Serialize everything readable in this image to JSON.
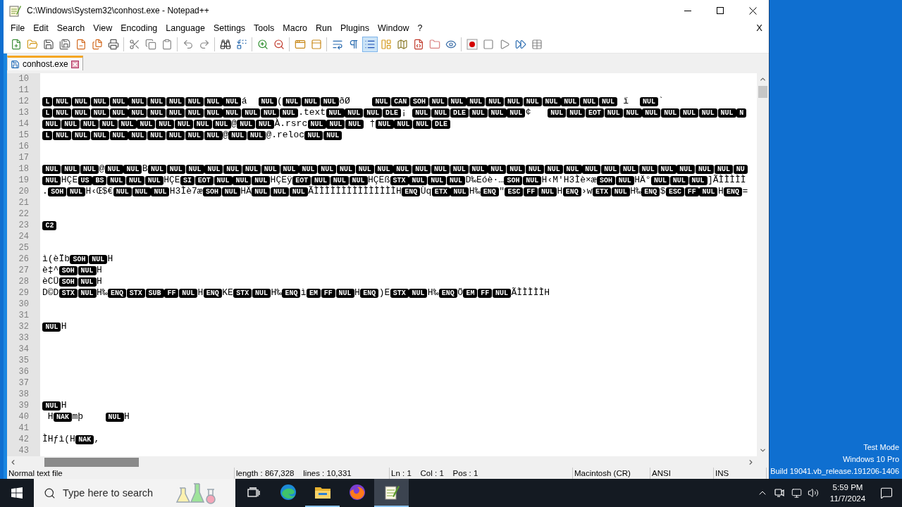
{
  "window": {
    "title": "C:\\Windows\\System32\\conhost.exe - Notepad++"
  },
  "menu": {
    "items": [
      "File",
      "Edit",
      "Search",
      "View",
      "Encoding",
      "Language",
      "Settings",
      "Tools",
      "Macro",
      "Run",
      "Plugins",
      "Window",
      "?"
    ],
    "close_label": "X"
  },
  "toolbar": {
    "groups": [
      [
        {
          "pressed": false
        },
        {
          "pressed": false
        },
        {
          "pressed": false
        },
        {
          "pressed": false
        },
        {
          "pressed": false
        },
        {
          "pressed": false
        },
        {
          "pressed": false
        }
      ],
      [
        {
          "pressed": false
        },
        {
          "pressed": false
        },
        {
          "pressed": false
        }
      ],
      [
        {
          "pressed": false
        },
        {
          "pressed": false
        }
      ],
      [
        {
          "pressed": false
        },
        {
          "pressed": false
        }
      ],
      [
        {
          "pressed": false
        },
        {
          "pressed": false
        }
      ],
      [
        {
          "pressed": false
        },
        {
          "pressed": false
        }
      ],
      [
        {
          "pressed": false
        },
        {
          "pressed": false
        },
        {
          "pressed": true
        },
        {
          "pressed": false
        },
        {
          "pressed": false
        },
        {
          "pressed": false
        },
        {
          "pressed": false
        },
        {
          "pressed": false
        }
      ],
      [
        {
          "pressed": false
        },
        {
          "pressed": false
        },
        {
          "pressed": false
        },
        {
          "pressed": false
        },
        {
          "pressed": false
        }
      ]
    ]
  },
  "tabs": [
    {
      "label": "conhost.exe",
      "selected": true
    }
  ],
  "editor": {
    "lines": [
      {
        "number": "10"
      },
      {
        "number": "11"
      },
      {
        "number": "12",
        "segments": [
          {
            "kind": "ctrl",
            "text": "L"
          },
          {
            "kind": "ctrl",
            "text": "NUL"
          },
          {
            "kind": "ctrl",
            "text": "NUL"
          },
          {
            "kind": "ctrl",
            "text": "NUL"
          },
          {
            "kind": "ctrl",
            "text": "NUL"
          },
          {
            "kind": "ctrl",
            "text": "NUL"
          },
          {
            "kind": "ctrl",
            "text": "NUL"
          },
          {
            "kind": "ctrl",
            "text": "NUL"
          },
          {
            "kind": "ctrl",
            "text": "NUL"
          },
          {
            "kind": "ctrl",
            "text": "NUL"
          },
          {
            "kind": "ctrl",
            "text": "NUL"
          },
          {
            "kind": "text",
            "text": "á  "
          },
          {
            "kind": "ctrl",
            "text": "NUL"
          },
          {
            "kind": "text",
            "text": "("
          },
          {
            "kind": "ctrl",
            "text": "NUL"
          },
          {
            "kind": "ctrl",
            "text": "NUL"
          },
          {
            "kind": "ctrl",
            "text": "NUL"
          },
          {
            "kind": "text",
            "text": "ðØ    "
          },
          {
            "kind": "ctrl",
            "text": "NUL"
          },
          {
            "kind": "ctrl",
            "text": "CAN"
          },
          {
            "kind": "ctrl",
            "text": "SOH"
          },
          {
            "kind": "ctrl",
            "text": "NUL"
          },
          {
            "kind": "ctrl",
            "text": "NUL"
          },
          {
            "kind": "ctrl",
            "text": "NUL"
          },
          {
            "kind": "ctrl",
            "text": "NUL"
          },
          {
            "kind": "ctrl",
            "text": "NUL"
          },
          {
            "kind": "ctrl",
            "text": "NUL"
          },
          {
            "kind": "ctrl",
            "text": "NUL"
          },
          {
            "kind": "ctrl",
            "text": "NUL"
          },
          {
            "kind": "ctrl",
            "text": "NUL"
          },
          {
            "kind": "ctrl",
            "text": "NUL"
          },
          {
            "kind": "text",
            "text": " ï  "
          },
          {
            "kind": "ctrl",
            "text": "NUL"
          },
          {
            "kind": "text",
            "text": "`"
          }
        ]
      },
      {
        "number": "13",
        "segments": [
          {
            "kind": "ctrl",
            "text": "L"
          },
          {
            "kind": "ctrl",
            "text": "NUL"
          },
          {
            "kind": "ctrl",
            "text": "NUL"
          },
          {
            "kind": "ctrl",
            "text": "NUL"
          },
          {
            "kind": "ctrl",
            "text": "NUL"
          },
          {
            "kind": "ctrl",
            "text": "NUL"
          },
          {
            "kind": "ctrl",
            "text": "NUL"
          },
          {
            "kind": "ctrl",
            "text": "NUL"
          },
          {
            "kind": "ctrl",
            "text": "NUL"
          },
          {
            "kind": "ctrl",
            "text": "NUL"
          },
          {
            "kind": "ctrl",
            "text": "NUL"
          },
          {
            "kind": "ctrl",
            "text": "NUL"
          },
          {
            "kind": "ctrl",
            "text": "NUL"
          },
          {
            "kind": "ctrl",
            "text": "NUL"
          },
          {
            "kind": "text",
            "text": ".text"
          },
          {
            "kind": "ctrl",
            "text": "NUL"
          },
          {
            "kind": "ctrl",
            "text": "NUL"
          },
          {
            "kind": "ctrl",
            "text": "NUL"
          },
          {
            "kind": "ctrl",
            "text": "DLE"
          },
          {
            "kind": "text",
            "text": "¡ "
          },
          {
            "kind": "ctrl",
            "text": "NUL"
          },
          {
            "kind": "ctrl",
            "text": "NUL"
          },
          {
            "kind": "ctrl",
            "text": "DLE"
          },
          {
            "kind": "ctrl",
            "text": "NUL"
          },
          {
            "kind": "ctrl",
            "text": "NUL"
          },
          {
            "kind": "ctrl",
            "text": "NUL"
          },
          {
            "kind": "text",
            "text": "¢   "
          },
          {
            "kind": "ctrl",
            "text": "NUL"
          },
          {
            "kind": "ctrl",
            "text": "NUL"
          },
          {
            "kind": "ctrl",
            "text": "EOT"
          },
          {
            "kind": "ctrl",
            "text": "NUL"
          },
          {
            "kind": "ctrl",
            "text": "NUL"
          },
          {
            "kind": "ctrl",
            "text": "NUL"
          },
          {
            "kind": "ctrl",
            "text": "NUL"
          },
          {
            "kind": "ctrl",
            "text": "NUL"
          },
          {
            "kind": "ctrl",
            "text": "NUL"
          },
          {
            "kind": "ctrl",
            "text": "NUL"
          },
          {
            "kind": "ctrl",
            "text": "N"
          }
        ]
      },
      {
        "number": "14",
        "segments": [
          {
            "kind": "ctrl",
            "text": "NUL"
          },
          {
            "kind": "ctrl",
            "text": "NUL"
          },
          {
            "kind": "ctrl",
            "text": "NUL"
          },
          {
            "kind": "ctrl",
            "text": "NUL"
          },
          {
            "kind": "ctrl",
            "text": "NUL"
          },
          {
            "kind": "ctrl",
            "text": "NUL"
          },
          {
            "kind": "ctrl",
            "text": "NUL"
          },
          {
            "kind": "ctrl",
            "text": "NUL"
          },
          {
            "kind": "ctrl",
            "text": "NUL"
          },
          {
            "kind": "ctrl",
            "text": "NUL"
          },
          {
            "kind": "text",
            "text": "@"
          },
          {
            "kind": "ctrl",
            "text": "NUL"
          },
          {
            "kind": "ctrl",
            "text": "NUL"
          },
          {
            "kind": "text",
            "text": "À.rsrc"
          },
          {
            "kind": "ctrl",
            "text": "NUL"
          },
          {
            "kind": "ctrl",
            "text": "NUL"
          },
          {
            "kind": "ctrl",
            "text": "NUL"
          },
          {
            "kind": "text",
            "text": " †"
          },
          {
            "kind": "ctrl",
            "text": "NUL"
          },
          {
            "kind": "ctrl",
            "text": "NUL"
          },
          {
            "kind": "ctrl",
            "text": "NUL"
          },
          {
            "kind": "ctrl",
            "text": "DLE"
          }
        ]
      },
      {
        "number": "15",
        "segments": [
          {
            "kind": "ctrl",
            "text": "L"
          },
          {
            "kind": "ctrl",
            "text": "NUL"
          },
          {
            "kind": "ctrl",
            "text": "NUL"
          },
          {
            "kind": "ctrl",
            "text": "NUL"
          },
          {
            "kind": "ctrl",
            "text": "NUL"
          },
          {
            "kind": "ctrl",
            "text": "NUL"
          },
          {
            "kind": "ctrl",
            "text": "NUL"
          },
          {
            "kind": "ctrl",
            "text": "NUL"
          },
          {
            "kind": "ctrl",
            "text": "NUL"
          },
          {
            "kind": "ctrl",
            "text": "NUL"
          },
          {
            "kind": "text",
            "text": "@"
          },
          {
            "kind": "ctrl",
            "text": "NUL"
          },
          {
            "kind": "ctrl",
            "text": "NUL"
          },
          {
            "kind": "text",
            "text": "@.reloc"
          },
          {
            "kind": "ctrl",
            "text": "NUL"
          },
          {
            "kind": "ctrl",
            "text": "NUL"
          }
        ]
      },
      {
        "number": "16"
      },
      {
        "number": "17"
      },
      {
        "number": "18",
        "segments": [
          {
            "kind": "ctrl",
            "text": "NUL"
          },
          {
            "kind": "ctrl",
            "text": "NUL"
          },
          {
            "kind": "ctrl",
            "text": "NUL"
          },
          {
            "kind": "text",
            "text": "@"
          },
          {
            "kind": "ctrl",
            "text": "NUL"
          },
          {
            "kind": "ctrl",
            "text": "NUL"
          },
          {
            "kind": "text",
            "text": "B"
          },
          {
            "kind": "ctrl",
            "text": "NUL"
          },
          {
            "kind": "ctrl",
            "text": "NUL"
          },
          {
            "kind": "ctrl",
            "text": "NUL"
          },
          {
            "kind": "ctrl",
            "text": "NUL"
          },
          {
            "kind": "ctrl",
            "text": "NUL"
          },
          {
            "kind": "ctrl",
            "text": "NUL"
          },
          {
            "kind": "ctrl",
            "text": "NUL"
          },
          {
            "kind": "ctrl",
            "text": "NUL"
          },
          {
            "kind": "ctrl",
            "text": "NUL"
          },
          {
            "kind": "ctrl",
            "text": "NUL"
          },
          {
            "kind": "ctrl",
            "text": "NUL"
          },
          {
            "kind": "ctrl",
            "text": "NUL"
          },
          {
            "kind": "ctrl",
            "text": "NUL"
          },
          {
            "kind": "ctrl",
            "text": "NUL"
          },
          {
            "kind": "ctrl",
            "text": "NUL"
          },
          {
            "kind": "ctrl",
            "text": "NUL"
          },
          {
            "kind": "ctrl",
            "text": "NUL"
          },
          {
            "kind": "ctrl",
            "text": "NUL"
          },
          {
            "kind": "ctrl",
            "text": "NUL"
          },
          {
            "kind": "ctrl",
            "text": "NUL"
          },
          {
            "kind": "ctrl",
            "text": "NUL"
          },
          {
            "kind": "ctrl",
            "text": "NUL"
          },
          {
            "kind": "ctrl",
            "text": "NUL"
          },
          {
            "kind": "ctrl",
            "text": "NUL"
          },
          {
            "kind": "ctrl",
            "text": "NUL"
          },
          {
            "kind": "ctrl",
            "text": "NUL"
          },
          {
            "kind": "ctrl",
            "text": "NUL"
          },
          {
            "kind": "ctrl",
            "text": "NUL"
          },
          {
            "kind": "ctrl",
            "text": "NUL"
          },
          {
            "kind": "ctrl",
            "text": "NUL"
          },
          {
            "kind": "ctrl",
            "text": "NUL"
          },
          {
            "kind": "ctrl",
            "text": "NU"
          }
        ]
      },
      {
        "number": "19",
        "segments": [
          {
            "kind": "ctrl",
            "text": "NUL"
          },
          {
            "kind": "text",
            "text": "HÇE"
          },
          {
            "kind": "ctrl",
            "text": "US"
          },
          {
            "kind": "ctrl",
            "text": "BS"
          },
          {
            "kind": "ctrl",
            "text": "NUL"
          },
          {
            "kind": "ctrl",
            "text": "NUL"
          },
          {
            "kind": "ctrl",
            "text": "NUL"
          },
          {
            "kind": "text",
            "text": "HÇE"
          },
          {
            "kind": "ctrl",
            "text": "SI"
          },
          {
            "kind": "ctrl",
            "text": "EOT"
          },
          {
            "kind": "ctrl",
            "text": "NUL"
          },
          {
            "kind": "ctrl",
            "text": "NUL"
          },
          {
            "kind": "ctrl",
            "text": "NUL"
          },
          {
            "kind": "text",
            "text": "HÇEÿ"
          },
          {
            "kind": "ctrl",
            "text": "EOT"
          },
          {
            "kind": "ctrl",
            "text": "NUL"
          },
          {
            "kind": "ctrl",
            "text": "NUL"
          },
          {
            "kind": "ctrl",
            "text": "NUL"
          },
          {
            "kind": "text",
            "text": "HÇEß"
          },
          {
            "kind": "ctrl",
            "text": "STX"
          },
          {
            "kind": "ctrl",
            "text": "NUL"
          },
          {
            "kind": "ctrl",
            "text": "NUL"
          },
          {
            "kind": "ctrl",
            "text": "NUL"
          },
          {
            "kind": "text",
            "text": "D‰Eóè·…"
          },
          {
            "kind": "ctrl",
            "text": "SOH"
          },
          {
            "kind": "ctrl",
            "text": "NUL"
          },
          {
            "kind": "text",
            "text": "H‹M'H3Ìè×æ"
          },
          {
            "kind": "ctrl",
            "text": "SOH"
          },
          {
            "kind": "ctrl",
            "text": "NUL"
          },
          {
            "kind": "text",
            "text": "HÄ°"
          },
          {
            "kind": "ctrl",
            "text": "NUL"
          },
          {
            "kind": "ctrl",
            "text": "NUL"
          },
          {
            "kind": "ctrl",
            "text": "NUL"
          },
          {
            "kind": "text",
            "text": "]ÃÌÌÌÌÌ"
          }
        ]
      },
      {
        "number": "20",
        "segments": [
          {
            "kind": "text",
            "text": "."
          },
          {
            "kind": "ctrl",
            "text": "SOH"
          },
          {
            "kind": "ctrl",
            "text": "NUL"
          },
          {
            "kind": "text",
            "text": "H‹Œ$€"
          },
          {
            "kind": "ctrl",
            "text": "NUL"
          },
          {
            "kind": "ctrl",
            "text": "NUL"
          },
          {
            "kind": "ctrl",
            "text": "NUL"
          },
          {
            "kind": "text",
            "text": "H3Ìè7æ"
          },
          {
            "kind": "ctrl",
            "text": "SOH"
          },
          {
            "kind": "ctrl",
            "text": "NUL"
          },
          {
            "kind": "text",
            "text": "HÄ"
          },
          {
            "kind": "ctrl",
            "text": "NUL"
          },
          {
            "kind": "ctrl",
            "text": "NUL"
          },
          {
            "kind": "ctrl",
            "text": "NUL"
          },
          {
            "kind": "text",
            "text": "ÃÌÌÌÌÌÌÌÌÌÌÌÌÌÌÌH"
          },
          {
            "kind": "ctrl",
            "text": "ENQ"
          },
          {
            "kind": "text",
            "text": "Ùq"
          },
          {
            "kind": "ctrl",
            "text": "ETX"
          },
          {
            "kind": "ctrl",
            "text": "NUL"
          },
          {
            "kind": "text",
            "text": "H‰"
          },
          {
            "kind": "ctrl",
            "text": "ENQ"
          },
          {
            "kind": "text",
            "text": "\""
          },
          {
            "kind": "ctrl",
            "text": "ESC"
          },
          {
            "kind": "ctrl",
            "text": "FF"
          },
          {
            "kind": "ctrl",
            "text": "NUL"
          },
          {
            "kind": "text",
            "text": "H"
          },
          {
            "kind": "ctrl",
            "text": "ENQ"
          },
          {
            "kind": "text",
            "text": "›w"
          },
          {
            "kind": "ctrl",
            "text": "ETX"
          },
          {
            "kind": "ctrl",
            "text": "NUL"
          },
          {
            "kind": "text",
            "text": "H‰"
          },
          {
            "kind": "ctrl",
            "text": "ENQ"
          },
          {
            "kind": "text",
            "text": "$"
          },
          {
            "kind": "ctrl",
            "text": "ESC"
          },
          {
            "kind": "ctrl",
            "text": "FF"
          },
          {
            "kind": "ctrl",
            "text": "NUL"
          },
          {
            "kind": "text",
            "text": "H"
          },
          {
            "kind": "ctrl",
            "text": "ENQ"
          },
          {
            "kind": "text",
            "text": "="
          }
        ]
      },
      {
        "number": "21"
      },
      {
        "number": "22"
      },
      {
        "number": "23",
        "segments": [
          {
            "kind": "ctrl",
            "text": "C2"
          }
        ]
      },
      {
        "number": "24"
      },
      {
        "number": "25"
      },
      {
        "number": "26",
        "segments": [
          {
            "kind": "text",
            "text": "ì(èÏb"
          },
          {
            "kind": "ctrl",
            "text": "SOH"
          },
          {
            "kind": "ctrl",
            "text": "NUL"
          },
          {
            "kind": "text",
            "text": "H"
          }
        ]
      },
      {
        "number": "27",
        "segments": [
          {
            "kind": "text",
            "text": "è‡^"
          },
          {
            "kind": "ctrl",
            "text": "SOH"
          },
          {
            "kind": "ctrl",
            "text": "NUL"
          },
          {
            "kind": "text",
            "text": "H"
          }
        ]
      },
      {
        "number": "28",
        "segments": [
          {
            "kind": "text",
            "text": "èCÜ"
          },
          {
            "kind": "ctrl",
            "text": "SOH"
          },
          {
            "kind": "ctrl",
            "text": "NUL"
          },
          {
            "kind": "text",
            "text": "H"
          }
        ]
      },
      {
        "number": "29",
        "segments": [
          {
            "kind": "text",
            "text": "D©D"
          },
          {
            "kind": "ctrl",
            "text": "STX"
          },
          {
            "kind": "ctrl",
            "text": "NUL"
          },
          {
            "kind": "text",
            "text": "H‰"
          },
          {
            "kind": "ctrl",
            "text": "ENQ"
          },
          {
            "kind": "ctrl",
            "text": "STX"
          },
          {
            "kind": "ctrl",
            "text": "SUB"
          },
          {
            "kind": "ctrl",
            "text": "FF"
          },
          {
            "kind": "ctrl",
            "text": "NUL"
          },
          {
            "kind": "text",
            "text": "H"
          },
          {
            "kind": "ctrl",
            "text": "ENQ"
          },
          {
            "kind": "text",
            "text": "KE"
          },
          {
            "kind": "ctrl",
            "text": "STX"
          },
          {
            "kind": "ctrl",
            "text": "NUL"
          },
          {
            "kind": "text",
            "text": "H‰"
          },
          {
            "kind": "ctrl",
            "text": "ENQ"
          },
          {
            "kind": "text",
            "text": "ì"
          },
          {
            "kind": "ctrl",
            "text": "EM"
          },
          {
            "kind": "ctrl",
            "text": "FF"
          },
          {
            "kind": "ctrl",
            "text": "NUL"
          },
          {
            "kind": "text",
            "text": "H"
          },
          {
            "kind": "ctrl",
            "text": "ENQ"
          },
          {
            "kind": "text",
            "text": ")E"
          },
          {
            "kind": "ctrl",
            "text": "STX"
          },
          {
            "kind": "ctrl",
            "text": "NUL"
          },
          {
            "kind": "text",
            "text": "H‰"
          },
          {
            "kind": "ctrl",
            "text": "ENQ"
          },
          {
            "kind": "text",
            "text": "Ö"
          },
          {
            "kind": "ctrl",
            "text": "EM"
          },
          {
            "kind": "ctrl",
            "text": "FF"
          },
          {
            "kind": "ctrl",
            "text": "NUL"
          },
          {
            "kind": "text",
            "text": "ÃÌÌÌÌÌH"
          }
        ]
      },
      {
        "number": "30"
      },
      {
        "number": "31"
      },
      {
        "number": "32",
        "segments": [
          {
            "kind": "ctrl",
            "text": "NUL"
          },
          {
            "kind": "text",
            "text": "H"
          }
        ]
      },
      {
        "number": "33"
      },
      {
        "number": "34"
      },
      {
        "number": "35"
      },
      {
        "number": "36"
      },
      {
        "number": "37"
      },
      {
        "number": "38"
      },
      {
        "number": "39",
        "segments": [
          {
            "kind": "ctrl",
            "text": "NUL"
          },
          {
            "kind": "text",
            "text": "H"
          }
        ]
      },
      {
        "number": "40",
        "segments": [
          {
            "kind": "text",
            "text": " H"
          },
          {
            "kind": "ctrl",
            "text": "NAK"
          },
          {
            "kind": "text",
            "text": "mþ    "
          },
          {
            "kind": "ctrl",
            "text": "NUL"
          },
          {
            "kind": "text",
            "text": "H"
          }
        ]
      },
      {
        "number": "41"
      },
      {
        "number": "42",
        "segments": [
          {
            "kind": "text",
            "text": "ÌHƒì(H"
          },
          {
            "kind": "ctrl",
            "text": "NAK"
          },
          {
            "kind": "text",
            "text": ","
          }
        ]
      },
      {
        "number": "43"
      }
    ]
  },
  "status_bar": {
    "fields": [
      "Normal text file",
      "length : 867,328    lines : 10,331",
      "Ln : 1    Col : 1    Pos : 1",
      "Macintosh (CR)",
      "ANSI",
      "INS"
    ]
  },
  "desktop": {
    "notice": [
      "Test Mode",
      "Windows 10 Pro",
      "Build 19041.vb_release.191206-1406"
    ]
  },
  "taskbar": {
    "search": {
      "placeholder": "Type here to search"
    },
    "apps": [
      {
        "running": false,
        "selected": false
      },
      {
        "running": true,
        "selected": false
      },
      {
        "running": false,
        "selected": false
      },
      {
        "running": true,
        "selected": true
      }
    ],
    "clock": {
      "time": "5:59 PM",
      "date": "11/7/2024"
    }
  }
}
